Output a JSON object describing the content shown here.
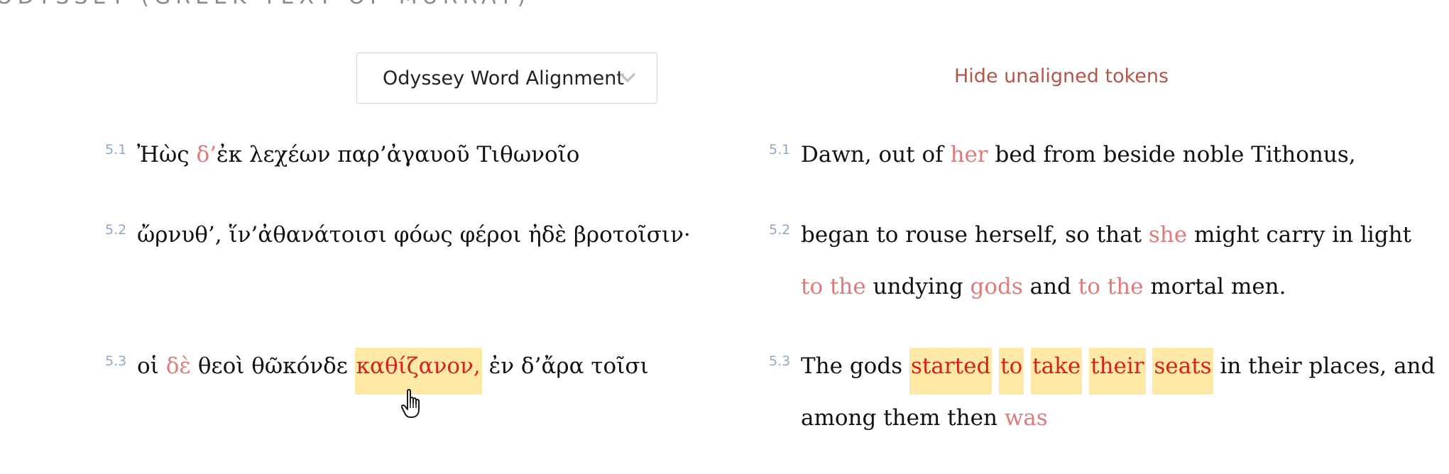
{
  "heading": "ODYSSEY (GREEK TEXT OF MURRAY)",
  "alignment_select": {
    "label": "Odyssey Word Alignment"
  },
  "hide_link": "Hide unaligned tokens",
  "greek": [
    {
      "ref": "5.1",
      "tokens": [
        {
          "text": "Ἠὼς ",
          "state": "normal"
        },
        {
          "text": "δ’",
          "state": "aligned"
        },
        {
          "text": "ἐκ λεχέων παρ’ἀγαυοῦ Τιθωνοῖο",
          "state": "normal"
        }
      ]
    },
    {
      "ref": "5.2",
      "tokens": [
        {
          "text": "ὤρνυθ’, ἵν’ἀθανάτοισι φόως φέροι ἠδὲ βροτοῖσιν·",
          "state": "normal"
        }
      ]
    },
    {
      "ref": "5.3",
      "tokens": [
        {
          "text": "οἱ ",
          "state": "normal"
        },
        {
          "text": "δὲ",
          "state": "aligned"
        },
        {
          "text": " θεοὶ θῶκόνδε ",
          "state": "normal"
        },
        {
          "text": "καθίζανον,",
          "state": "active"
        },
        {
          "text": " ἐν δ’ἄρα τοῖσι",
          "state": "normal"
        }
      ]
    }
  ],
  "english": [
    {
      "ref": "5.1",
      "lines": [
        [
          {
            "text": "Dawn, out of ",
            "state": "normal"
          },
          {
            "text": "her",
            "state": "aligned"
          },
          {
            "text": " bed from beside noble Tithonus,",
            "state": "normal"
          }
        ]
      ]
    },
    {
      "ref": "5.2",
      "lines": [
        [
          {
            "text": "began to rouse herself, so that ",
            "state": "normal"
          },
          {
            "text": "she",
            "state": "aligned"
          },
          {
            "text": " might carry in light",
            "state": "normal"
          }
        ],
        [
          {
            "text": "to the",
            "state": "aligned"
          },
          {
            "text": " undying ",
            "state": "normal"
          },
          {
            "text": "gods",
            "state": "aligned"
          },
          {
            "text": " and ",
            "state": "normal"
          },
          {
            "text": "to the",
            "state": "aligned"
          },
          {
            "text": " mortal men.",
            "state": "normal"
          }
        ]
      ]
    },
    {
      "ref": "5.3",
      "lines": [
        [
          {
            "text": "The gods ",
            "state": "normal"
          },
          {
            "text": "started",
            "state": "active"
          },
          {
            "text": " ",
            "state": "normal"
          },
          {
            "text": "to",
            "state": "active"
          },
          {
            "text": " ",
            "state": "normal"
          },
          {
            "text": "take",
            "state": "active"
          },
          {
            "text": " ",
            "state": "normal"
          },
          {
            "text": "their",
            "state": "active"
          },
          {
            "text": " ",
            "state": "normal"
          },
          {
            "text": "seats",
            "state": "active"
          },
          {
            "text": " in their places, and",
            "state": "normal"
          }
        ],
        [
          {
            "text": "among them then ",
            "state": "normal"
          },
          {
            "text": "was",
            "state": "aligned"
          }
        ]
      ]
    }
  ],
  "colors": {
    "aligned": "#e07a7a",
    "active_text": "#d42020",
    "active_bg": "#fde8a6",
    "link": "#b5554a",
    "ref": "#8fa8c8"
  },
  "icons": [
    "chevron-down-icon",
    "hand-pointer-cursor-icon"
  ]
}
